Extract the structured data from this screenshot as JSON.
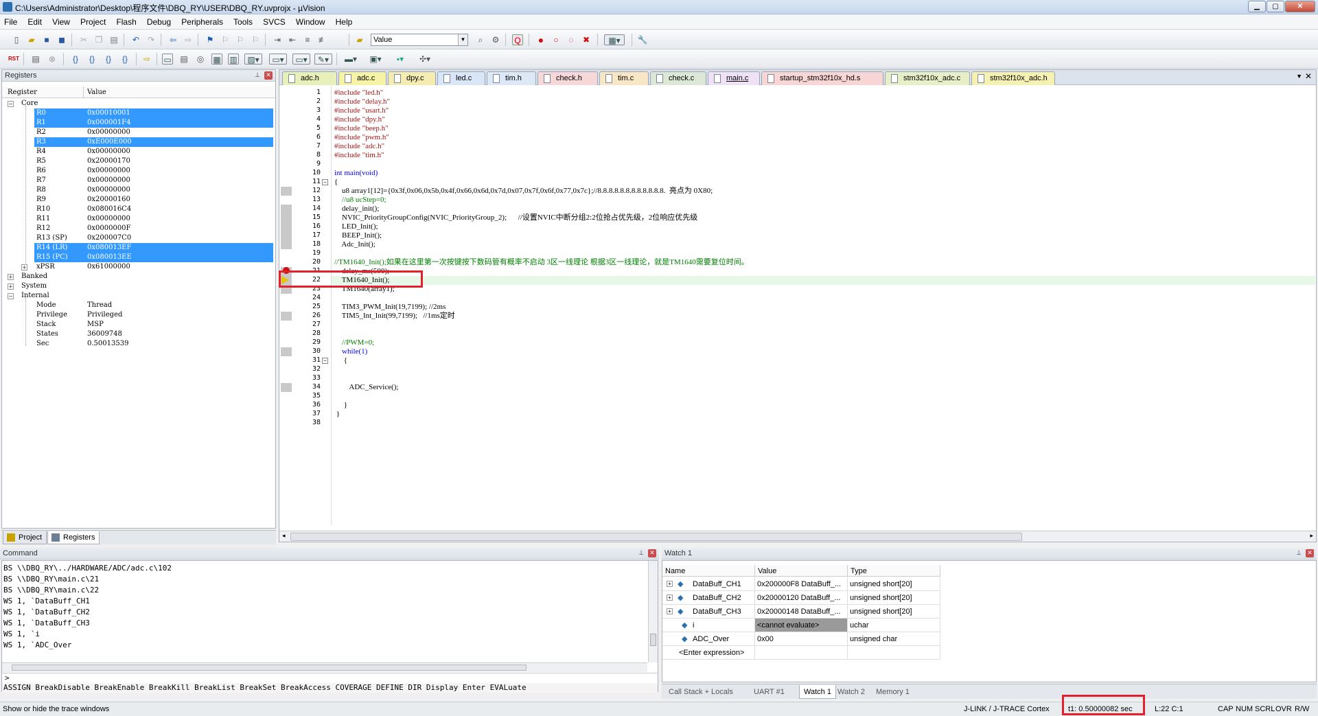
{
  "window": {
    "title": "C:\\Users\\Administrator\\Desktop\\程序文件\\DBQ_RY\\USER\\DBQ_RY.uvprojx - µVision"
  },
  "menu": [
    "File",
    "Edit",
    "View",
    "Project",
    "Flash",
    "Debug",
    "Peripherals",
    "Tools",
    "SVCS",
    "Window",
    "Help"
  ],
  "toolbar": {
    "watch_value": "Value"
  },
  "registers": {
    "title": "Registers",
    "col_register": "Register",
    "col_value": "Value",
    "groups": {
      "core": "Core",
      "banked": "Banked",
      "system": "System",
      "internal": "Internal"
    },
    "core": [
      {
        "name": "R0",
        "value": "0x00010001",
        "sel": true
      },
      {
        "name": "R1",
        "value": "0x000001F4",
        "sel": true
      },
      {
        "name": "R2",
        "value": "0x00000000",
        "sel": false
      },
      {
        "name": "R3",
        "value": "0xE000E000",
        "sel": true
      },
      {
        "name": "R4",
        "value": "0x00000000",
        "sel": false
      },
      {
        "name": "R5",
        "value": "0x20000170",
        "sel": false
      },
      {
        "name": "R6",
        "value": "0x00000000",
        "sel": false
      },
      {
        "name": "R7",
        "value": "0x00000000",
        "sel": false
      },
      {
        "name": "R8",
        "value": "0x00000000",
        "sel": false
      },
      {
        "name": "R9",
        "value": "0x20000160",
        "sel": false
      },
      {
        "name": "R10",
        "value": "0x080016C4",
        "sel": false
      },
      {
        "name": "R11",
        "value": "0x00000000",
        "sel": false
      },
      {
        "name": "R12",
        "value": "0x0000000F",
        "sel": false
      },
      {
        "name": "R13 (SP)",
        "value": "0x200007C0",
        "sel": false
      },
      {
        "name": "R14 (LR)",
        "value": "0x080013EF",
        "sel": true
      },
      {
        "name": "R15 (PC)",
        "value": "0x080013EE",
        "sel": true
      },
      {
        "name": "xPSR",
        "value": "0x61000000",
        "sel": false
      }
    ],
    "internal": [
      {
        "name": "Mode",
        "value": "Thread"
      },
      {
        "name": "Privilege",
        "value": "Privileged"
      },
      {
        "name": "Stack",
        "value": "MSP"
      },
      {
        "name": "States",
        "value": "36009748"
      },
      {
        "name": "Sec",
        "value": "0.50013539"
      }
    ]
  },
  "left_tabs": {
    "project": "Project",
    "registers": "Registers"
  },
  "editor": {
    "tabs": [
      {
        "label": "adc.h",
        "color": "#e6f0b8"
      },
      {
        "label": "adc.c",
        "color": "#f6f2a6"
      },
      {
        "label": "dpy.c",
        "color": "#f4ecb0"
      },
      {
        "label": "led.c",
        "color": "#d8e6f8"
      },
      {
        "label": "tim.h",
        "color": "#dce8f6"
      },
      {
        "label": "check.h",
        "color": "#f6d8d8"
      },
      {
        "label": "tim.c",
        "color": "#f9e6c4"
      },
      {
        "label": "check.c",
        "color": "#dde7d6"
      },
      {
        "label": "main.c",
        "color": "#efe2f6",
        "active": true
      },
      {
        "label": "startup_stm32f10x_hd.s",
        "color": "#f8d6d6"
      },
      {
        "label": "stm32f10x_adc.c",
        "color": "#e6efc8"
      },
      {
        "label": "stm32f10x_adc.h",
        "color": "#f5f1b2"
      }
    ],
    "lines": [
      {
        "n": "1",
        "text": "#include \"led.h\""
      },
      {
        "n": "2",
        "text": "#include \"delay.h\""
      },
      {
        "n": "3",
        "text": "#include \"usart.h\""
      },
      {
        "n": "4",
        "text": "#include \"dpy.h\""
      },
      {
        "n": "5",
        "text": "#include \"beep.h\""
      },
      {
        "n": "6",
        "text": "#include \"pwm.h\""
      },
      {
        "n": "7",
        "text": "#include \"adc.h\""
      },
      {
        "n": "8",
        "text": "#include \"tim.h\""
      },
      {
        "n": "9",
        "text": ""
      },
      {
        "n": "10",
        "text": "int main(void)"
      },
      {
        "n": "11",
        "text": "{"
      },
      {
        "n": "12",
        "text": "    u8 array1[12]={0x3f,0x06,0x5b,0x4f,0x66,0x6d,0x7d,0x07,0x7f,0x6f,0x77,0x7c};//8.8.8.8.8.8.8.8.8.8.8.8.  亮点为 0X80;"
      },
      {
        "n": "13",
        "text": "    //u8 ucStep=0;"
      },
      {
        "n": "14",
        "text": "    delay_init();"
      },
      {
        "n": "15",
        "text": "    NVIC_PriorityGroupConfig(NVIC_PriorityGroup_2);      //设置NVIC中断分组2:2位抢占优先级，2位响应优先级"
      },
      {
        "n": "16",
        "text": "    LED_Init();"
      },
      {
        "n": "17",
        "text": "    BEEP_Init();"
      },
      {
        "n": "18",
        "text": "    Adc_Init();"
      },
      {
        "n": "19",
        "text": ""
      },
      {
        "n": "20",
        "text": "//TM1640_Init();如果在这里第一次按键按下数码管有概率不启动 3区一线理论 根据3区一线理论，就是TM1640需要复位时间。"
      },
      {
        "n": "21",
        "text": "    delay_ms(500);"
      },
      {
        "n": "22",
        "text": "    TM1640_Init();"
      },
      {
        "n": "23",
        "text": "    TM1640(array1);"
      },
      {
        "n": "24",
        "text": ""
      },
      {
        "n": "25",
        "text": "    TIM3_PWM_Init(19,7199); //2ms"
      },
      {
        "n": "26",
        "text": "    TIM5_Int_Init(99,7199);   //1ms定时"
      },
      {
        "n": "27",
        "text": ""
      },
      {
        "n": "28",
        "text": ""
      },
      {
        "n": "29",
        "text": "    //PWM=0;"
      },
      {
        "n": "30",
        "text": "    while(1)"
      },
      {
        "n": "31",
        "text": "     {"
      },
      {
        "n": "32",
        "text": ""
      },
      {
        "n": "33",
        "text": ""
      },
      {
        "n": "34",
        "text": "        ADC_Service();"
      },
      {
        "n": "35",
        "text": ""
      },
      {
        "n": "36",
        "text": "     }"
      },
      {
        "n": "37",
        "text": " }"
      },
      {
        "n": "38",
        "text": ""
      }
    ]
  },
  "command": {
    "title": "Command",
    "lines": [
      "BS \\\\DBQ_RY\\../HARDWARE/ADC/adc.c\\102",
      "BS \\\\DBQ_RY\\main.c\\21",
      "BS \\\\DBQ_RY\\main.c\\22",
      "WS 1, `DataBuff_CH1",
      "WS 1, `DataBuff_CH2",
      "WS 1, `DataBuff_CH3",
      "WS 1, `i",
      "WS 1, `ADC_Over"
    ],
    "prompt": ">",
    "help": "ASSIGN BreakDisable BreakEnable BreakKill BreakList BreakSet BreakAccess COVERAGE DEFINE DIR Display Enter EVALuate"
  },
  "watch": {
    "title": "Watch 1",
    "col_name": "Name",
    "col_value": "Value",
    "col_type": "Type",
    "rows": [
      {
        "name": "DataBuff_CH1",
        "value": "0x200000F8 DataBuff_...",
        "type": "unsigned short[20]",
        "expand": true
      },
      {
        "name": "DataBuff_CH2",
        "value": "0x20000120 DataBuff_...",
        "type": "unsigned short[20]",
        "expand": true
      },
      {
        "name": "DataBuff_CH3",
        "value": "0x20000148 DataBuff_...",
        "type": "unsigned short[20]",
        "expand": true
      },
      {
        "name": "i",
        "value": "<cannot evaluate>",
        "type": "uchar",
        "expand": false
      },
      {
        "name": "ADC_Over",
        "value": "0x00",
        "type": "unsigned char",
        "expand": false
      },
      {
        "name": "<Enter expression>",
        "value": "",
        "type": "",
        "expand": false
      }
    ],
    "tabs": [
      "Call Stack + Locals",
      "UART #1",
      "Watch 1",
      "Watch 2",
      "Memory 1"
    ]
  },
  "status": {
    "hint": "Show or hide the trace windows",
    "debugger": "J-LINK / J-TRACE Cortex",
    "time": "t1: 0.50000082 sec",
    "pos": "L:22 C:1",
    "flags": [
      "CAP",
      "NUM",
      "SCRL",
      "OVR",
      "R/W"
    ]
  }
}
